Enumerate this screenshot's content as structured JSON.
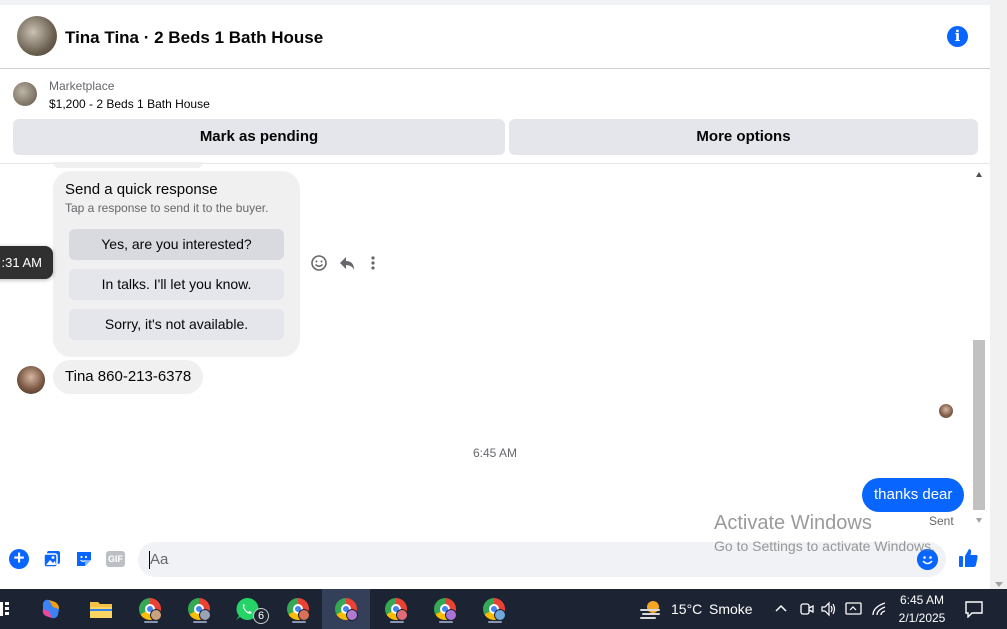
{
  "header": {
    "title": "Tina Tina · 2 Beds 1 Bath House",
    "info_icon": "info-icon"
  },
  "listing": {
    "source": "Marketplace",
    "price_title": "$1,200 - 2 Beds 1 Bath House",
    "mark_pending": "Mark as pending",
    "more_options": "More options"
  },
  "chat": {
    "tooltip_time": ":31 AM",
    "quick_response": {
      "title": "Send a quick response",
      "subtitle": "Tap a response to send it to the buyer.",
      "options": [
        "Yes, are you interested?",
        "In talks. I'll let you know.",
        "Sorry, it's not available."
      ]
    },
    "contact_message": "Tina 860-213-6378",
    "timestamp": "6:45 AM",
    "sent_message": "thanks dear",
    "sent_status": "Sent"
  },
  "watermark": {
    "line1": "Activate Windows",
    "line2": "Go to Settings to activate Windows."
  },
  "composer": {
    "placeholder": "Aa",
    "gif_label": "GIF"
  },
  "taskbar": {
    "weather_temp": "15°C",
    "weather_text": "Smoke",
    "time": "6:45 AM",
    "date": "2/1/2025",
    "whatsapp_badge": "6"
  },
  "colors": {
    "accent": "#0866ff",
    "bubble_gray": "#f0f0f0",
    "taskbar_bg": "#1c2333"
  }
}
